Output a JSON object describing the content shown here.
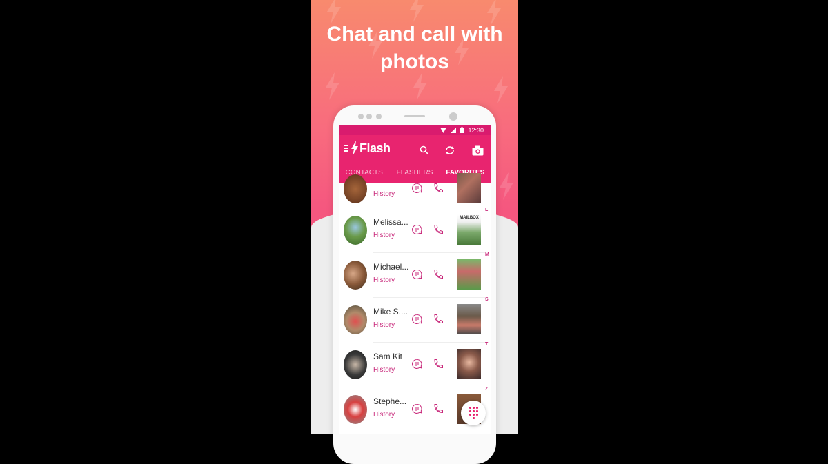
{
  "promo": {
    "headline_line1": "Chat and call with",
    "headline_line2": "photos",
    "background_color": "#f5577f",
    "decoration_icon": "lightning-bolt-icon"
  },
  "status_bar": {
    "time": "12:30",
    "icons": [
      "wifi-icon",
      "signal-icon",
      "battery-icon"
    ]
  },
  "app_bar": {
    "app_name": "Flash",
    "logo_icon": "lightning-bolt-icon",
    "actions": [
      "search-icon",
      "refresh-icon",
      "camera-icon"
    ],
    "color": "#e8246f"
  },
  "tabs": [
    {
      "label": "CONTACTS",
      "active": false
    },
    {
      "label": "FLASHERS",
      "active": false
    },
    {
      "label": "FAVORITES",
      "active": true
    }
  ],
  "contacts": [
    {
      "name": "",
      "history_label": "History",
      "section_letter": ""
    },
    {
      "name": "Melissa...",
      "history_label": "History",
      "section_letter": "L"
    },
    {
      "name": "Michael...",
      "history_label": "History",
      "section_letter": "M"
    },
    {
      "name": "Mike S....",
      "history_label": "History",
      "section_letter": "S"
    },
    {
      "name": "Sam Kit",
      "history_label": "History",
      "section_letter": "T"
    },
    {
      "name": "Stephe...",
      "history_label": "History",
      "section_letter": "Z"
    }
  ],
  "thumb_overlay_text": "MAILBOX",
  "fab": {
    "icon": "dialpad-icon"
  },
  "accent_color": "#c8287a"
}
